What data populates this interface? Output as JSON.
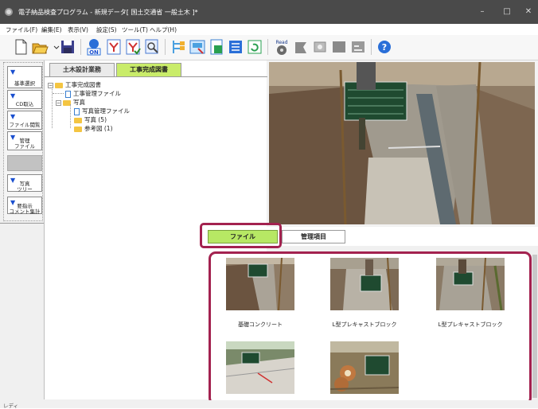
{
  "window": {
    "title": "電子納品検査プログラム - 新規データ[ 国土交通省 一般土木 ]*",
    "controls": {
      "minimize": "–",
      "maximize": "□",
      "close": "✕"
    }
  },
  "menu": [
    "ファイル(F)",
    "編集(E)",
    "表示(V)",
    "設定(S)",
    "ツール(T)",
    "ヘルプ(H)"
  ],
  "toolbar": {
    "icons": [
      "new-file-icon",
      "open-folder-icon",
      "save-icon",
      "on-icon",
      "ye-icon",
      "ye-check-icon",
      "search-icon",
      "tree-icon",
      "image-edit-icon",
      "document-icon",
      "list-icon",
      "refresh-icon",
      "read-icon",
      "stamp-icon",
      "disk-icon",
      "card-icon",
      "chart-icon",
      "help-icon"
    ],
    "on_label": "ON",
    "read_label": "Read"
  },
  "left_buttons": [
    {
      "label": "基準選択"
    },
    {
      "label": "CD取込"
    },
    {
      "label": "ファイル閲覧"
    },
    {
      "label": "管理\nファイル"
    },
    {
      "label": ""
    },
    {
      "label": "写真\nツリー"
    },
    {
      "label": "要指示\nコメント集計"
    }
  ],
  "tree_tabs": {
    "left": "土木設計業務",
    "right": "工事完成図書"
  },
  "tree": {
    "root": "工事完成図書",
    "mgmt_file": "工事管理ファイル",
    "photos": "写真",
    "photo_mgmt_file": "写真管理ファイル",
    "photo_folder": "写真 (5)",
    "reference": "参考図 (1)"
  },
  "bottom_tabs": {
    "file": "ファイル",
    "management": "管理項目"
  },
  "thumbnails": [
    {
      "caption": "基礎コンクリート"
    },
    {
      "caption": "L型プレキャストブロック"
    },
    {
      "caption": "L型プレキャストブロック"
    },
    {
      "caption": ""
    },
    {
      "caption": ""
    }
  ],
  "status": {
    "text": "レディ"
  },
  "colors": {
    "highlight": "#a3224f",
    "active_tab": "#b7e864",
    "titlebar": "#4a4a4a"
  }
}
